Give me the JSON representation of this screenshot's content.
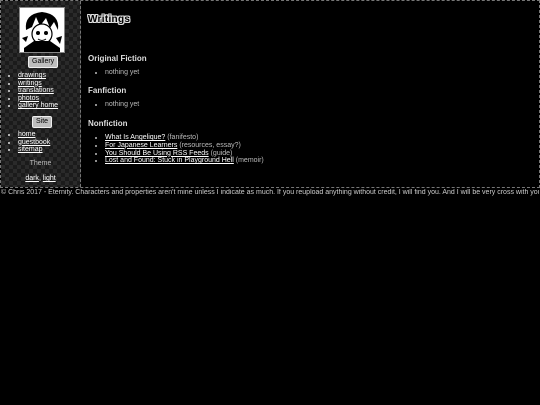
{
  "sidebar": {
    "gallery_button": "Gallery",
    "gallery_links": [
      {
        "label": "drawings"
      },
      {
        "label": "writings"
      },
      {
        "label": "translations"
      },
      {
        "label": "photos"
      },
      {
        "label": "gallery home"
      }
    ],
    "site_button": "Site",
    "site_links": [
      {
        "label": "home"
      },
      {
        "label": "guestbook"
      },
      {
        "label": "sitemap"
      }
    ],
    "theme_label": "Theme",
    "theme_options": [
      "dark",
      "light"
    ]
  },
  "main": {
    "title": "Writings",
    "sections": [
      {
        "heading": "Original Fiction",
        "items": [
          {
            "text": "nothing yet"
          }
        ]
      },
      {
        "heading": "Fanfiction",
        "items": [
          {
            "text": "nothing yet"
          }
        ]
      },
      {
        "heading": "Nonfiction",
        "items": [
          {
            "link": "What Is Angelique?",
            "note": "(fanifesto)"
          },
          {
            "link": "For Japanese Learners",
            "note": "(resources, essay?)"
          },
          {
            "link": "You Should Be Using RSS Feeds",
            "note": "(guide)"
          },
          {
            "link": "Lost and Found: Stuck in Playground Hell",
            "note": "(memoir)"
          }
        ]
      }
    ]
  },
  "footer": {
    "text": "© Chris 2017 - Eternity. Characters and properties aren't mine unless I indicate as much. If you reupload anything without credit, I will find you. And I will be very cross with you."
  },
  "colors": {
    "background": "#000000",
    "text": "#dddddd",
    "button": "#bdbdbd"
  },
  "icons": {
    "avatar": "manga-character-avatar"
  }
}
